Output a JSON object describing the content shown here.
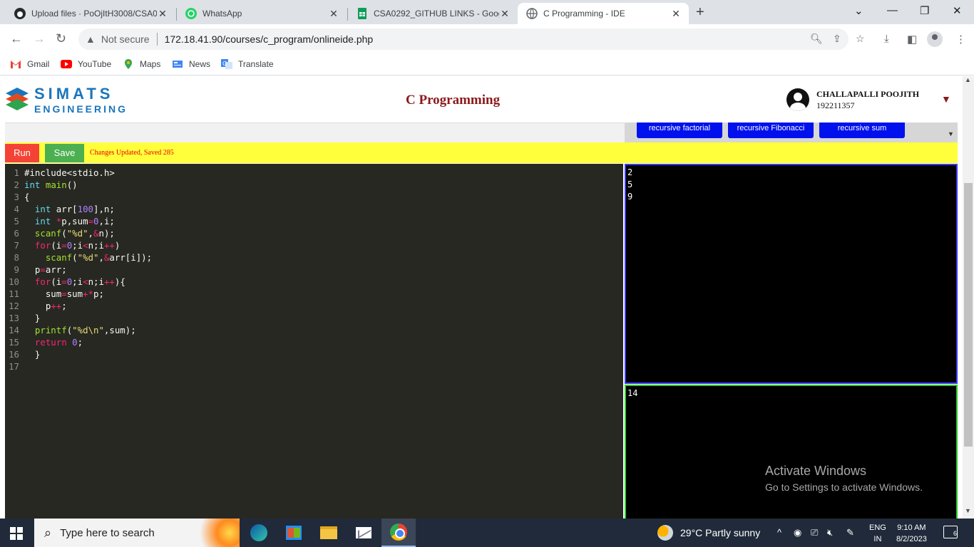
{
  "browser": {
    "tabs": [
      {
        "title": "Upload files · PoOjItH3008/CSA0",
        "icon": "github-icon"
      },
      {
        "title": "WhatsApp",
        "icon": "whatsapp-icon"
      },
      {
        "title": "CSA0292_GITHUB LINKS - Googl",
        "icon": "sheets-icon"
      },
      {
        "title": "C Programming - IDE",
        "icon": "globe-icon",
        "active": true
      }
    ],
    "address": {
      "security_label": "Not secure",
      "url": "172.18.41.90/courses/c_program/onlineide.php"
    },
    "bookmarks": [
      {
        "label": "Gmail",
        "icon": "gmail-icon"
      },
      {
        "label": "YouTube",
        "icon": "youtube-icon"
      },
      {
        "label": "Maps",
        "icon": "maps-icon"
      },
      {
        "label": "News",
        "icon": "news-icon"
      },
      {
        "label": "Translate",
        "icon": "translate-icon"
      }
    ]
  },
  "header": {
    "logo_line1": "SIMATS",
    "logo_line2": "ENGINEERING",
    "course_title": "C Programming",
    "user_name": "CHALLAPALLI POOJITH",
    "user_id": "192211357",
    "caret": "▼"
  },
  "samples": [
    "recursive factorial",
    "recursive Fibonacci",
    "recursive sum"
  ],
  "actions": {
    "run_label": "Run",
    "save_label": "Save",
    "status": "Changes Updated, Saved 285"
  },
  "editor": {
    "line_numbers": [
      "1",
      "2",
      "3",
      "4",
      "5",
      "6",
      "7",
      "8",
      "9",
      "10",
      "11",
      "12",
      "13",
      "14",
      "15",
      "16",
      "17"
    ]
  },
  "input_text": "2\n5\n9",
  "output_text": "14",
  "watermark": {
    "line1": "Activate Windows",
    "line2": "Go to Settings to activate Windows."
  },
  "taskbar": {
    "search_placeholder": "Type here to search",
    "weather": "29°C  Partly sunny",
    "lang1": "ENG",
    "lang2": "IN",
    "time": "9:10 AM",
    "date": "8/2/2023",
    "notifications": "6"
  }
}
